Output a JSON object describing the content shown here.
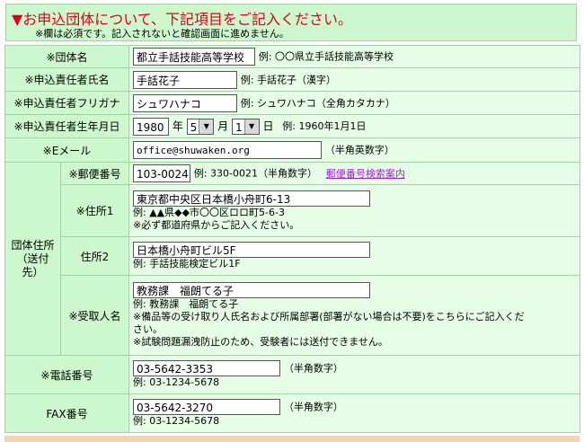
{
  "header": {
    "title": "▼お申込団体について、下記項目をご記入ください。",
    "note": "※欄は必須です。記入されないと確認画面に進めません。"
  },
  "org_name": {
    "label": "※団体名",
    "value": "都立手話技能高等学校",
    "example": "例: 〇〇県立手話技能高等学校"
  },
  "rep_name": {
    "label": "※申込責任者氏名",
    "value": "手話花子",
    "example": "例: 手話花子（漢字）"
  },
  "rep_kana": {
    "label": "※申込責任者フリガナ",
    "value": "シュワハナコ",
    "example": "例: シュワハナコ（全角カタカナ）"
  },
  "birthdate": {
    "label": "※申込責任者生年月日",
    "year": "1980",
    "year_unit": "年",
    "month": "5",
    "month_unit": "月",
    "day": "1",
    "day_unit": "日",
    "example": "例: 1960年1月1日"
  },
  "email": {
    "label": "※Eメール",
    "value": "office@shuwaken.org",
    "note": "（半角英数字）"
  },
  "address_group": {
    "label_line1": "団体住所",
    "label_line2": "（送付先）"
  },
  "postal": {
    "label": "※郵便番号",
    "value": "103-0024",
    "example": "例: 330-0021（半角数字）",
    "link": "郵便番号検索案内"
  },
  "address1": {
    "label": "※住所1",
    "value": "東京都中央区日本橋小舟町6-13",
    "example": "例: ▲▲県◆◆市〇〇区ロロ町5-6-3",
    "note": "※必ず都道府県からご記入ください。"
  },
  "address2": {
    "label": "住所2",
    "value": "日本橋小舟町ビル5F",
    "example": "例: 手話技能検定ビル1F"
  },
  "recipient": {
    "label": "※受取人名",
    "value": "教務課　福朗てる子",
    "example": "例: 教務課　福朗てる子",
    "note1": "※備品等の受け取り人氏名および所属部署(部署がない場合は不要)をこちらにご記入くだ",
    "note1b": "さい。",
    "note2": "※試験問題漏洩防止のため、受験者には送付できません。"
  },
  "phone": {
    "label": "※電話番号",
    "value": "03-5642-3353",
    "note": "（半角数字）",
    "example": "例: 03-1234-5678"
  },
  "fax": {
    "label": "FAX番号",
    "value": "03-5642-3270",
    "note": "（半角数字）",
    "example": "例: 03-1234-5678"
  }
}
